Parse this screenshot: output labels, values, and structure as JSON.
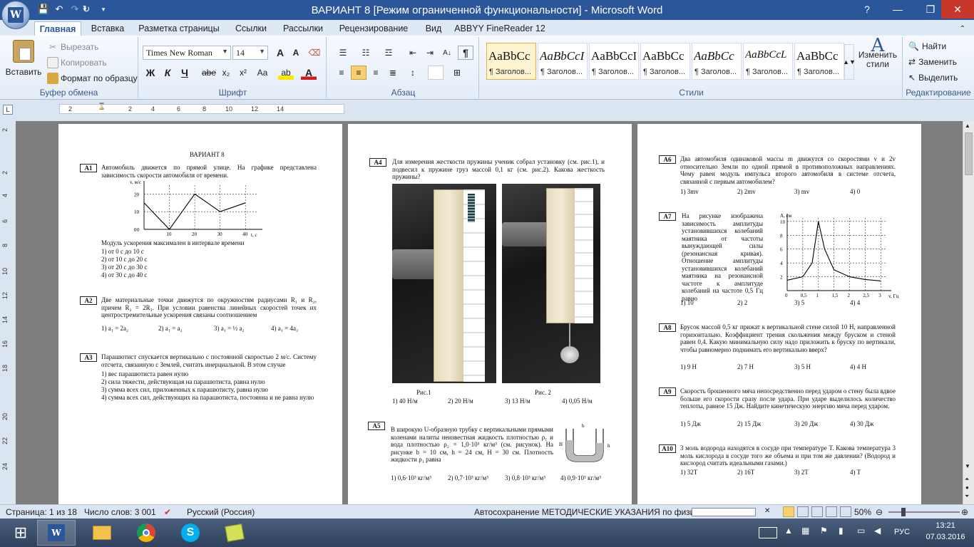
{
  "window": {
    "title": "ВАРИАНТ 8 [Режим ограниченной функциональности] - Microsoft Word",
    "help": "?",
    "minimize": "—",
    "restore": "❐",
    "close": "✕"
  },
  "tabs": [
    "Главная",
    "Вставка",
    "Разметка страницы",
    "Ссылки",
    "Рассылки",
    "Рецензирование",
    "Вид",
    "ABBYY FineReader 12"
  ],
  "ribbon": {
    "clipboard": {
      "paste": "Вставить",
      "cut": "Вырезать",
      "copy": "Копировать",
      "format_painter": "Формат по образцу",
      "label": "Буфер обмена"
    },
    "font": {
      "font_name": "Times New Roman",
      "font_size": "14",
      "label": "Шрифт",
      "bold": "Ж",
      "italic": "К",
      "underline": "Ч",
      "strike": "abe",
      "sub": "x₂",
      "sup": "x²",
      "case": "Aa",
      "grow": "A",
      "shrink": "A"
    },
    "paragraph": {
      "label": "Абзац",
      "show_marks": "¶"
    },
    "styles": {
      "label": "Стили",
      "items": [
        {
          "preview": "AaBbCc",
          "name": "¶ Заголов..."
        },
        {
          "preview": "AaBbCcI",
          "name": "¶ Заголов..."
        },
        {
          "preview": "AaBbCcI",
          "name": "¶ Заголов..."
        },
        {
          "preview": "AaBbCc",
          "name": "¶ Заголов..."
        },
        {
          "preview": "AaBbCc",
          "name": "¶ Заголов..."
        },
        {
          "preview": "AaBbCcL",
          "name": "¶ Заголов..."
        },
        {
          "preview": "AaBbCc",
          "name": "¶ Заголов..."
        }
      ],
      "change": "Изменить стили"
    },
    "editing": {
      "find": "Найти",
      "replace": "Заменить",
      "select": "Выделить",
      "label": "Редактирование"
    }
  },
  "ruler": {
    "ticks": [
      "2",
      "2",
      "4",
      "6",
      "8",
      "10",
      "12",
      "14"
    ],
    "vticks": [
      "2",
      "2",
      "4",
      "6",
      "8",
      "10",
      "12",
      "14",
      "16",
      "18",
      "20",
      "22",
      "24"
    ]
  },
  "page1": {
    "variant_title": "ВАРИАНТ 8",
    "a1": {
      "num": "А1",
      "text": "Автомобиль движется по прямой улице. На графике представлена зависимость скорости автомобиля от времени.",
      "ylabel": "v, м/с",
      "xlabel": "t, с",
      "question": "Модуль ускорения максимален в интервале времени",
      "options": [
        "1)  от 0 с до 10 с",
        "2)  от 10 с до 20 с",
        "3)  от 20 с до 30 с",
        "4)  от 30 с до 40 с"
      ]
    },
    "a2": {
      "num": "А2",
      "text": "Две материальные точки движутся по окружностям радиусами R₁ и R₂, причем R₂ = 2R₁. При условии равенства линейных скоростей точек их центростремительные ускорения связаны соотношением",
      "options": [
        "1)  a₁ = 2a₂",
        "2)  a₁ = a₂",
        "3)  a₁ = ½ a₂",
        "4)  a₁ = 4a₂"
      ]
    },
    "a3": {
      "num": "А3",
      "text": "Парашютист спускается вертикально с постоянной скоростью 2 м/с. Систему отсчета, связанную с Землей, считать инерциальной. В этом случае",
      "options": [
        "1)  вес парашютиста равен нулю",
        "2)  сила тяжести, действующая на парашютиста, равна нулю",
        "3)  сумма всех сил, приложенных к парашютисту, равна нулю",
        "4)  сумма всех сил, действующих на парашютиста, постоянна и не равна нулю"
      ]
    }
  },
  "page2": {
    "a4": {
      "num": "А4",
      "text": "Для измерения жесткости пружины ученик собрал установку (см. рис.1), и подвесил к пружине груз массой 0,1 кг (см. рис.2). Какова жесткость пружины?",
      "fig1": "Рис.1",
      "fig2": "Рис. 2",
      "options": [
        "1)  40 Н/м",
        "2)  20 Н/м",
        "3)  13 Н/м",
        "4)  0,05 Н/м"
      ]
    },
    "a5": {
      "num": "А5",
      "text": "В широкую U-образную трубку с вертикальными прямыми коленами налиты неизвестная жидкость плотностью ρ₁ и вода плотностью ρ₂ = 1,0·10³ кг/м³ (см. рисунок). На рисунке b = 10 см, h = 24 см, H = 30 см. Плотность жидкости ρ₁ равна",
      "options": [
        "1)  0,6·10³ кг/м³",
        "2)  0,7·10³ кг/м³",
        "3)  0,8·10³ кг/м³",
        "4)  0,9·10³ кг/м³"
      ]
    }
  },
  "page3": {
    "a6": {
      "num": "А6",
      "text": "Два автомобиля одинаковой массы m движутся со скоростями v и 2v относительно Земли по одной прямой в противоположных направлениях. Чему равен модуль импульса второго автомобиля в системе отсчета, связанной с первым автомобилем?",
      "options": [
        "1)  3mv",
        "2)  2mv",
        "3)  mv",
        "4)  0"
      ]
    },
    "a7": {
      "num": "А7",
      "text": "На рисунке изображена зависимость амплитуды установившихся колебаний маятника от частоты вынуждающей силы (резонансная кривая). Отношение амплитуды установившихся колебаний маятника на резонансной частоте к амплитуде колебаний на частоте 0,5 Гц равно",
      "ylabel": "A, см",
      "xlabel": "v, Гц",
      "options": [
        "1)  10",
        "2)  2",
        "3)  5",
        "4)  4"
      ]
    },
    "a8": {
      "num": "А8",
      "text": "Брусок массой 0,5 кг прижат к вертикальной стене силой 10 Н, направленной горизонтально. Коэффициент трения скольжения между бруском и стеной равен 0,4. Какую минимальную силу надо приложить к бруску по вертикали, чтобы равномерно поднимать его вертикально вверх?",
      "options": [
        "1)  9 Н",
        "2)  7 Н",
        "3)  5 Н",
        "4)  4 Н"
      ]
    },
    "a9": {
      "num": "А9",
      "text": "Скорость брошенного мяча непосредственно перед ударом о стену была вдвое больше его скорости сразу после удара. При ударе выделилось количество теплоты, равное 15 Дж. Найдите кинетическую энергию мяча перед ударом.",
      "options": [
        "1)  5 Дж",
        "2)  15 Дж",
        "3)  20 Дж",
        "4)  30 Дж"
      ]
    },
    "a10": {
      "num": "А10",
      "text": "3 моль водорода находятся в сосуде при температуре T. Какова температура 3 моль кислорода в сосуде того же объема и при том же давлении? (Водород и кислород считать идеальными газами.)",
      "options": [
        "1)  32T",
        "2)  16T",
        "3)  2T",
        "4)  T"
      ]
    }
  },
  "status": {
    "page": "Страница: 1 из 18",
    "words": "Число слов: 3 001",
    "lang": "Русский (Россия)",
    "autosave": "Автосохранение МЕТОДИЧЕСКИЕ УКАЗАНИЯ по физике:",
    "zoom": "50%"
  },
  "taskbar": {
    "lang": "РУС",
    "time": "13:21",
    "date": "07.03.2016"
  },
  "chart_data": [
    {
      "type": "line",
      "title": "",
      "xlabel": "t, с",
      "ylabel": "v, м/с",
      "x": [
        0,
        10,
        20,
        30,
        40
      ],
      "y": [
        15,
        0,
        20,
        10,
        15
      ],
      "xticks": [
        10,
        20,
        30,
        40
      ],
      "yticks": [
        0,
        10,
        20
      ],
      "xlim": [
        0,
        45
      ],
      "ylim": [
        0,
        25
      ],
      "grid": true
    },
    {
      "type": "line",
      "title": "",
      "xlabel": "v, Гц",
      "ylabel": "A, см",
      "x": [
        0,
        0.5,
        0.8,
        1.0,
        1.2,
        1.5,
        2,
        2.5,
        3
      ],
      "y": [
        1.5,
        2,
        4,
        10,
        6,
        3,
        2,
        1.6,
        1.4
      ],
      "xticks": [
        0,
        0.5,
        1,
        1.5,
        2,
        2.5,
        3
      ],
      "yticks": [
        2,
        4,
        6,
        8,
        10
      ],
      "xlim": [
        0,
        3.2
      ],
      "ylim": [
        0,
        10.5
      ],
      "grid": true
    }
  ],
  "colors": {
    "accent": "#2b579a",
    "ribbon_bg": "#e4ecf7",
    "doc_bg": "#7e7e7e"
  }
}
